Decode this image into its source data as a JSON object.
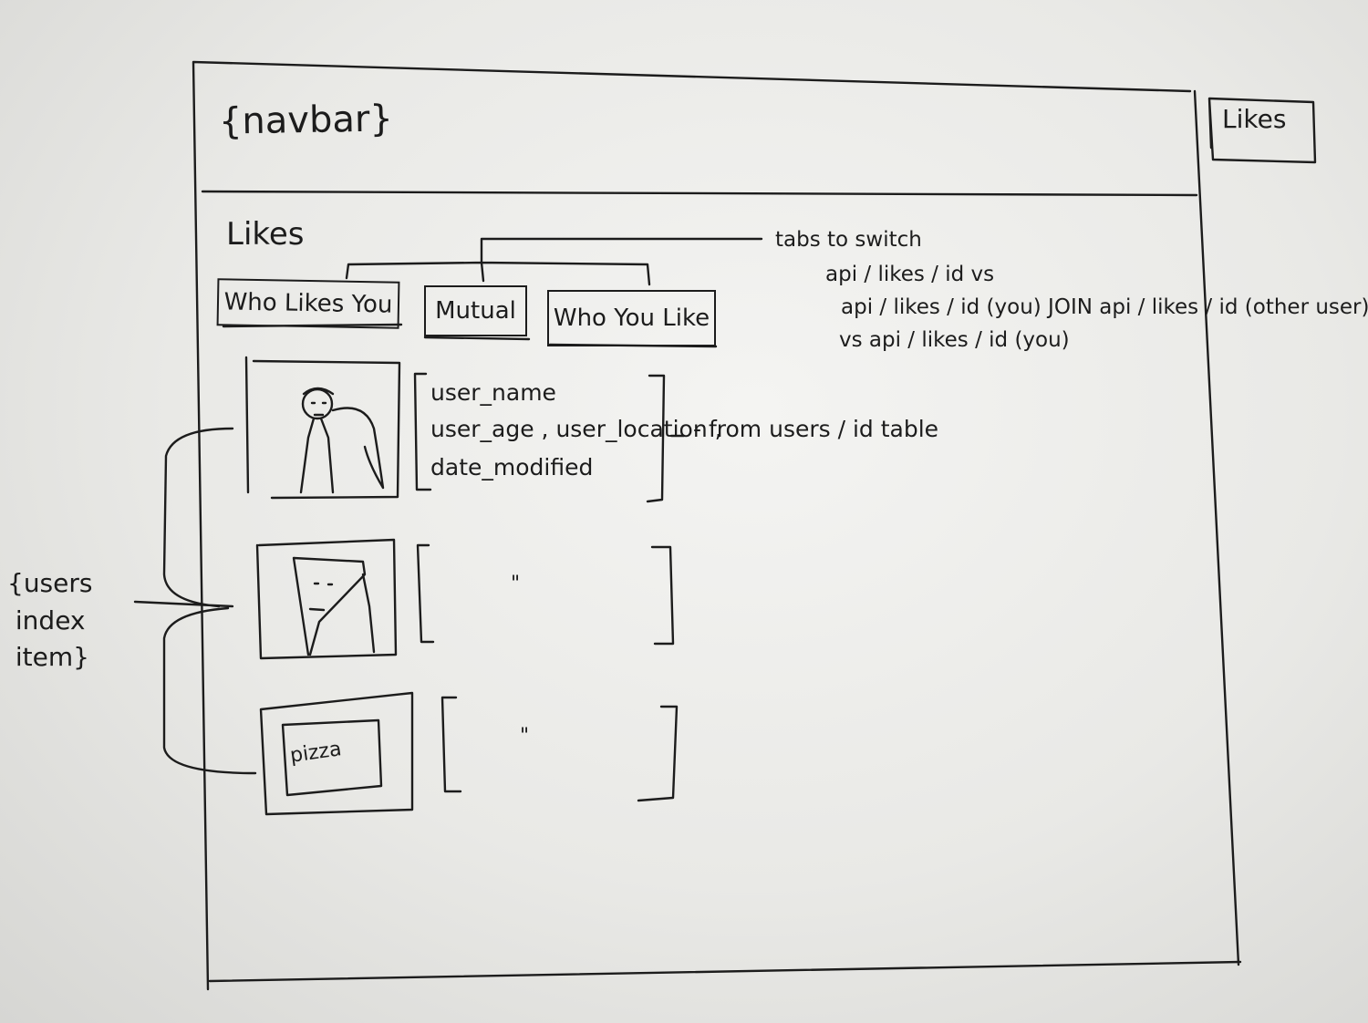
{
  "navbar": {
    "label": "{navbar}"
  },
  "sidebar": {
    "likes_label": "Likes"
  },
  "page": {
    "title": "Likes"
  },
  "tabs": [
    {
      "label": "Who Likes You"
    },
    {
      "label": "Mutual"
    },
    {
      "label": "Who You Like"
    }
  ],
  "annotations": {
    "tabs_note": [
      "tabs to switch",
      "api / likes / id  vs",
      "api / likes / id  (you)  JOIN  api / likes / id (other user)",
      "vs  api / likes / id  (you)"
    ],
    "fields_note": "- from  users / id  table",
    "users_index_item": "{users\n index\n item}"
  },
  "users": [
    {
      "fields": [
        "user_name",
        "user_age , user_location ,",
        "date_modified"
      ]
    },
    {
      "ditto": "\""
    },
    {
      "ditto": "\"",
      "image_label": "pizza"
    }
  ]
}
